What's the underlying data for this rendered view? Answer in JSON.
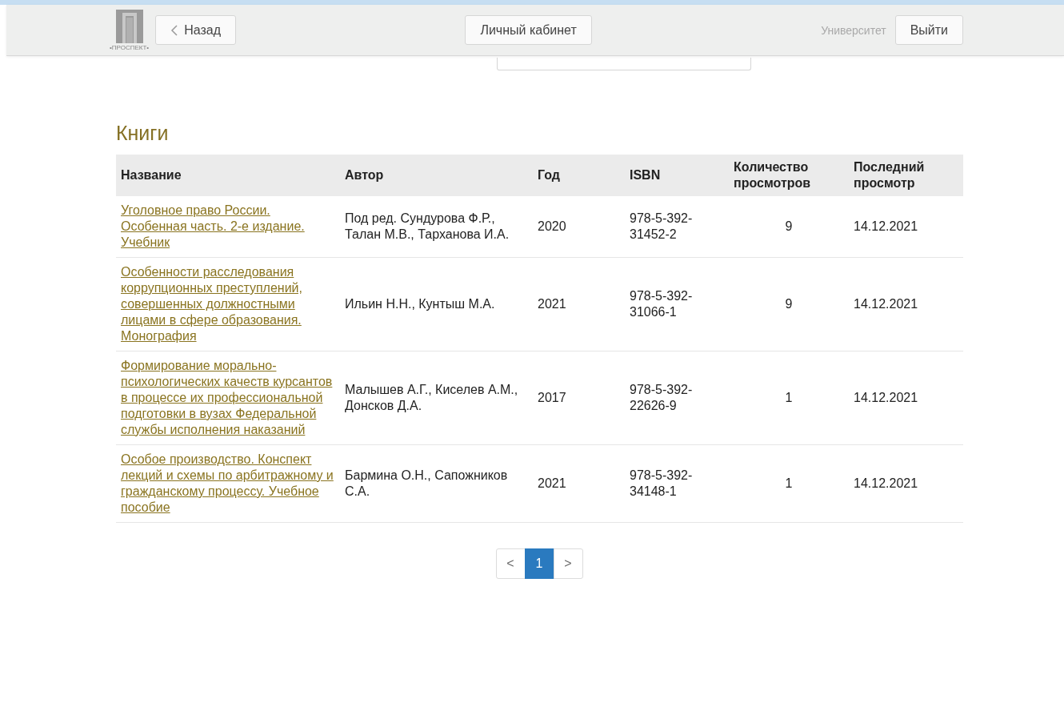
{
  "header": {
    "back_button": "Назад",
    "center_button": "Личный кабинет",
    "organization": "Университет",
    "logout_button": "Выйти",
    "logo_caption": "•ПРОСПЕКТ•"
  },
  "books": {
    "title": "Книги",
    "columns": [
      "Название",
      "Автор",
      "Год",
      "ISBN",
      "Количество просмотров",
      "Последний просмотр"
    ],
    "rows": [
      {
        "title": "Уголовное право России. Особенная часть. 2-е издание. Учебник",
        "author": "Под ред. Сундурова Ф.Р., Талан М.В., Тарханова И.А.",
        "year": "2020",
        "isbn": "978-5-392-31452-2",
        "views": "9",
        "last_view": "14.12.2021"
      },
      {
        "title": "Особенности расследования коррупционных преступлений, совершенных должностными лицами в сфере образования. Монография",
        "author": "Ильин Н.Н., Кунтыш М.А.",
        "year": "2021",
        "isbn": "978-5-392-31066-1",
        "views": "9",
        "last_view": "14.12.2021"
      },
      {
        "title": "Формирование морально-психологических качеств курсантов в процессе их профессиональной подготовки в вузах Федеральной службы исполнения наказаний",
        "author": "Малышев А.Г., Киселев А.М., Донсков Д.А.",
        "year": "2017",
        "isbn": "978-5-392-22626-9",
        "views": "1",
        "last_view": "14.12.2021"
      },
      {
        "title": "Особое производство. Конспект лекций и схемы по арбитражному и гражданскому процессу. Учебное пособие",
        "author": "Бармина О.Н., Сапожников С.А.",
        "year": "2021",
        "isbn": "978-5-392-34148-1",
        "views": "1",
        "last_view": "14.12.2021"
      }
    ]
  },
  "pagination": {
    "prev": "<",
    "next": ">",
    "pages": [
      {
        "label": "1",
        "selected": true
      }
    ]
  }
}
